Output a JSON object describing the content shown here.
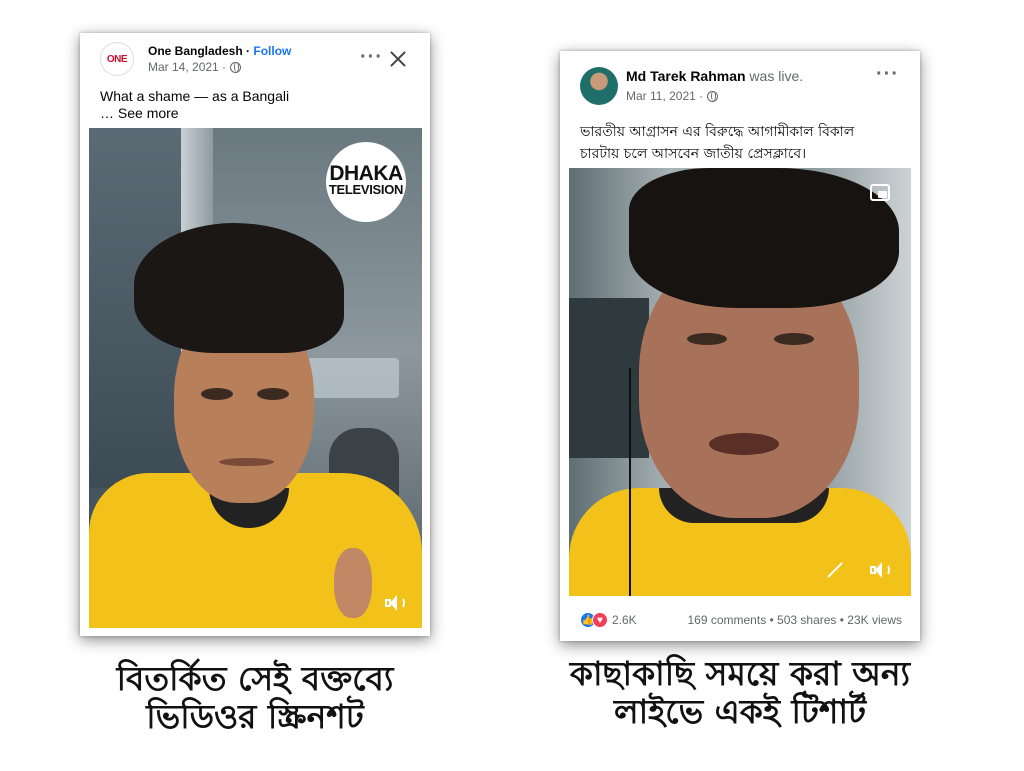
{
  "left_post": {
    "page_name": "One Bangladesh",
    "separator": " · ",
    "follow_label": "Follow",
    "date": "Mar 14, 2021 ·",
    "avatar_text": "ONE",
    "text_line1": "What a shame — as a Bangali",
    "text_line2": "… See more",
    "badge_line1": "DHAKA",
    "badge_line2": "TELEVISION",
    "more_icon": "more-horizontal-icon",
    "close_icon": "close-icon",
    "sound_icon": "speaker-icon"
  },
  "right_post": {
    "author": "Md Tarek Rahman",
    "status": " was live.",
    "date": "Mar 11, 2021 ·",
    "text_line1": "ভারতীয় আগ্রাসন এর বিরুদ্ধে আগামীকাল বিকাল",
    "text_line2": "চারটায় চলে আসবেন জাতীয় প্রেসক্লাবে।",
    "reaction_count": "2.6K",
    "stats": "169 comments • 503 shares • 23K views",
    "pip_icon": "picture-in-picture-icon",
    "expand_icon": "expand-icon",
    "sound_icon": "speaker-icon"
  },
  "captions": {
    "left_line1": "বিতর্কিত সেই বক্তব্যে",
    "left_line2": "ভিডিওর স্ক্রিনশট",
    "right_line1": "কাছাকাছি সময়ে করা অন্য",
    "right_line2": "লাইভে একই টিশার্ট"
  },
  "colors": {
    "link_blue": "#1877f2",
    "shirt_yellow": "#f2c21b",
    "meta_gray": "#65676b"
  }
}
